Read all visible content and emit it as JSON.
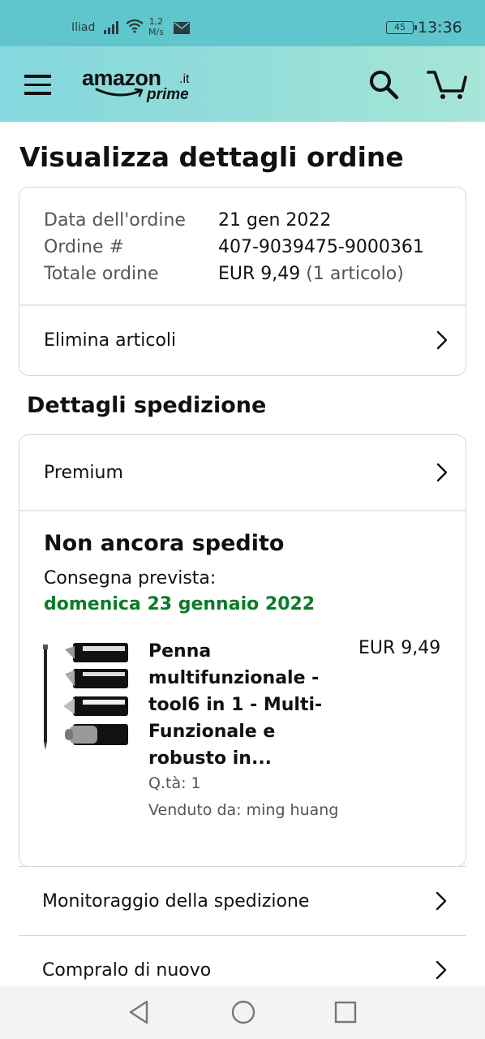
{
  "status_bar": {
    "carrier": "Iliad",
    "speed_value": "1,2",
    "speed_unit": "M/s",
    "battery": "45",
    "time": "13:36"
  },
  "header": {
    "logo_main": "amazon",
    "logo_tld": ".it",
    "logo_sub": "prime",
    "icons": [
      "menu-icon",
      "search-icon",
      "cart-icon"
    ]
  },
  "page": {
    "title": "Visualizza dettagli ordine"
  },
  "order_summary": {
    "date_label": "Data dell'ordine",
    "date_value": "21 gen 2022",
    "number_label": "Ordine #",
    "number_value": "407-9039475-9000361",
    "total_label": "Totale ordine",
    "total_value": "EUR 9,49",
    "total_items": "(1 articolo)",
    "remove_items_label": "Elimina articoli"
  },
  "shipping": {
    "section_title": "Dettagli spedizione",
    "service_label": "Premium",
    "status": "Non ancora spedito",
    "delivery_label": "Consegna prevista:",
    "delivery_date": "domenica 23 gennaio 2022",
    "delivery_date_color": "#0a7b27",
    "product": {
      "title": "Penna multifunzionale - tool6 in 1 - Multi-Funzionale e robusto in...",
      "price": "EUR 9,49",
      "quantity": "Q.tà: 1",
      "seller": "Venduto da: ming huang"
    }
  },
  "actions": {
    "track_label": "Monitoraggio della spedizione",
    "buy_again_label": "Compralo di nuovo"
  },
  "nav_bar": {
    "icons": [
      "back-icon",
      "home-icon",
      "recent-apps-icon"
    ]
  }
}
